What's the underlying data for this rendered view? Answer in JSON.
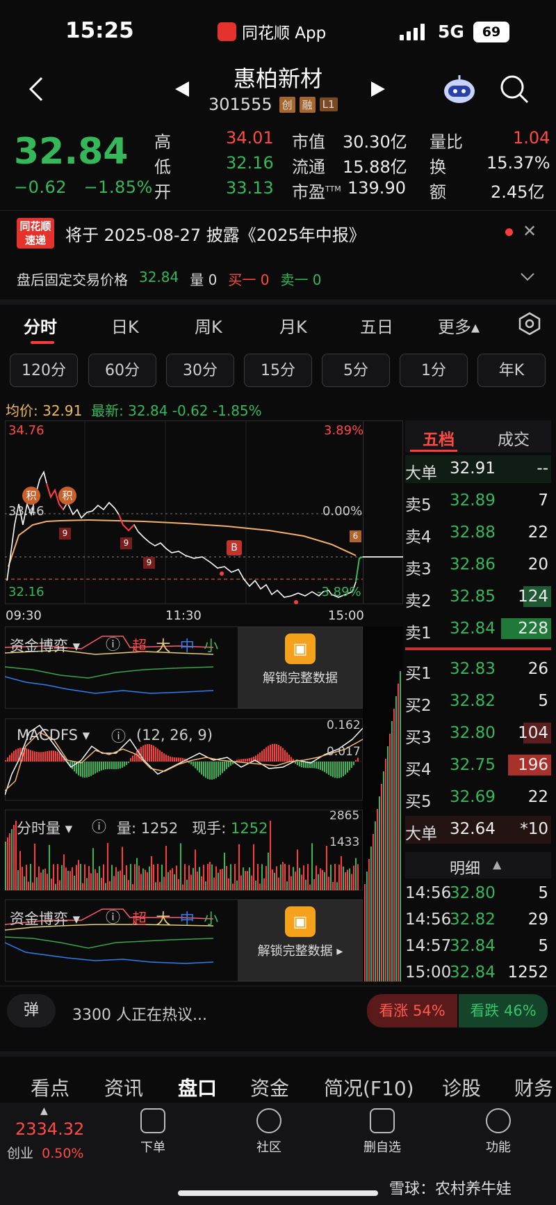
{
  "status_bar": {
    "time": "15:25",
    "app_name": "同花顺 App",
    "network": "5G",
    "battery": "69"
  },
  "header": {
    "stock_name": "惠柏新材",
    "stock_code": "301555",
    "tags": [
      "创",
      "融",
      "L1"
    ]
  },
  "quote": {
    "price": "32.84",
    "change": "−0.62",
    "change_pct": "−1.85%",
    "high_label": "高",
    "high": "34.01",
    "low_label": "低",
    "low": "32.16",
    "open_label": "开",
    "open": "33.13",
    "mcap_label": "市值",
    "mcap": "30.30亿",
    "float_label": "流通",
    "float": "15.88亿",
    "pe_label": "市盈",
    "pe_sup": "TTM",
    "pe": "139.90",
    "vr_label": "量比",
    "vr": "1.04",
    "turnover_label": "换",
    "turnover": "15.37%",
    "amount_label": "额",
    "amount": "2.45亿"
  },
  "news": {
    "logo_line1": "同花顺",
    "logo_line2": "速递",
    "text": "将于 2025-08-27 披露《2025年中报》"
  },
  "after_hours": {
    "label": "盘后固定交易价格",
    "price": "32.84",
    "vol": "量 0",
    "buy1": "买一 0",
    "sell1": "卖一 0"
  },
  "period_tabs": [
    "分时",
    "日K",
    "周K",
    "月K",
    "五日",
    "更多▴"
  ],
  "minute_buttons": [
    "120分",
    "60分",
    "30分",
    "15分",
    "5分",
    "1分",
    "年K"
  ],
  "avg": {
    "avg_text": "均价: 32.91",
    "latest_text": "最新: 32.84  -0.62  -1.85%"
  },
  "chart": {
    "y_max": "34.76",
    "y_max_pct": "3.89%",
    "y_mid": "33.46",
    "y_mid_pct": "0.00%",
    "y_min": "32.16",
    "y_min_pct": "-3.89%",
    "x_labels": [
      "09:30",
      "11:30",
      "15:00"
    ],
    "markers": [
      "积",
      "积",
      "9",
      "9",
      "9",
      "B",
      "6"
    ]
  },
  "indicators": {
    "capital": {
      "label": "资金博弈",
      "legend": [
        "超",
        "大",
        "中",
        "小"
      ],
      "lock_text": "解锁完整数据"
    },
    "macd": {
      "label": "MACDFS",
      "params": "(12, 26, 9)",
      "v1": "0.162",
      "v2": "0.017"
    },
    "volume": {
      "label": "分时量",
      "vol_text": "量: 1252",
      "now_label": "现手:",
      "now_value": "1252",
      "v1": "2865",
      "v2": "1433"
    }
  },
  "order_book": {
    "tabs": [
      "五档",
      "成交"
    ],
    "big_sell": {
      "label": "大单",
      "price": "32.91",
      "vol": "--"
    },
    "sells": [
      {
        "label": "卖5",
        "price": "32.89",
        "vol": "7"
      },
      {
        "label": "卖4",
        "price": "32.88",
        "vol": "22"
      },
      {
        "label": "卖3",
        "price": "32.86",
        "vol": "20"
      },
      {
        "label": "卖2",
        "price": "32.85",
        "vol": "124"
      },
      {
        "label": "卖1",
        "price": "32.84",
        "vol": "228"
      }
    ],
    "buys": [
      {
        "label": "买1",
        "price": "32.83",
        "vol": "26"
      },
      {
        "label": "买2",
        "price": "32.82",
        "vol": "5"
      },
      {
        "label": "买3",
        "price": "32.80",
        "vol": "104"
      },
      {
        "label": "买4",
        "price": "32.75",
        "vol": "196"
      },
      {
        "label": "买5",
        "price": "32.69",
        "vol": "22"
      }
    ],
    "big_buy": {
      "label": "大单",
      "price": "32.64",
      "vol": "*10"
    },
    "detail_label": "明细",
    "details": [
      {
        "time": "14:56",
        "price": "32.80",
        "vol": "5"
      },
      {
        "time": "14:56",
        "price": "32.82",
        "vol": "29"
      },
      {
        "time": "14:57",
        "price": "32.84",
        "vol": "5"
      },
      {
        "time": "15:00",
        "price": "32.84",
        "vol": "1252"
      }
    ]
  },
  "discussion": {
    "avatar": "弹",
    "text": "3300 人正在热议...",
    "up": "看涨 54%",
    "down": "看跌 46%"
  },
  "bottom_tabs": [
    "看点",
    "资讯",
    "盘口",
    "资金",
    "简况(F10)",
    "诊股",
    "财务"
  ],
  "dock": {
    "index_value": "2334.32",
    "index_name": "创业",
    "index_pct": "0.50%",
    "items": [
      "下单",
      "社区",
      "删自选",
      "功能"
    ]
  },
  "watermark": "雪球：农村养牛娃"
}
